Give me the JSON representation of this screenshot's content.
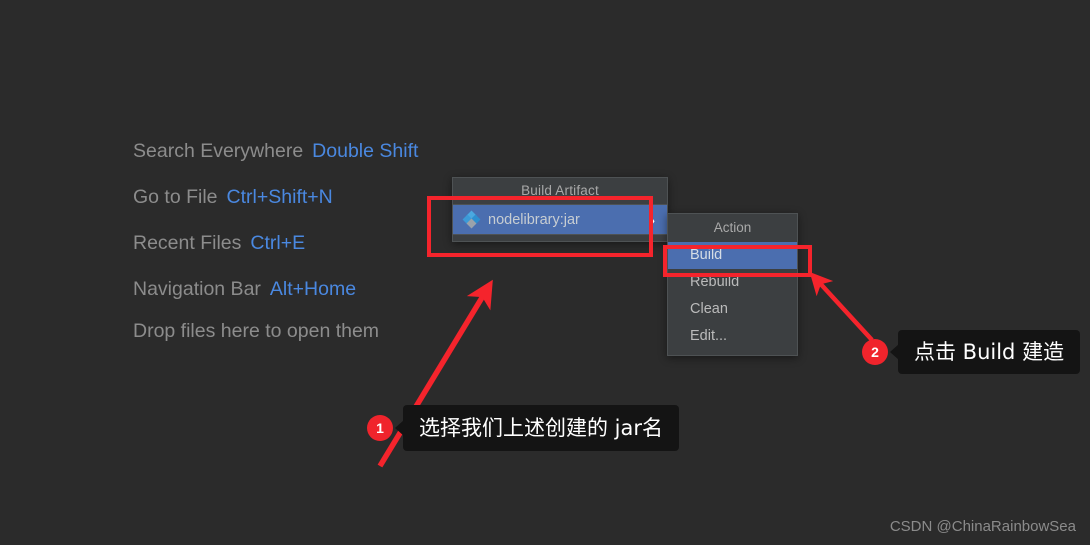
{
  "editor": {
    "hints": [
      {
        "label": "Search Everywhere",
        "shortcut": "Double Shift"
      },
      {
        "label": "Go to File",
        "shortcut": "Ctrl+Shift+N"
      },
      {
        "label": "Recent Files",
        "shortcut": "Ctrl+E"
      },
      {
        "label": "Navigation Bar",
        "shortcut": "Alt+Home"
      }
    ],
    "drop_hint": "Drop files here to open them"
  },
  "build_artifact_popup": {
    "title": "Build Artifact",
    "items": [
      {
        "label": "nodelibrary:jar",
        "icon": "artifact-diamonds-icon",
        "submenu_arrow": "›",
        "selected": true
      }
    ]
  },
  "action_popup": {
    "title": "Action",
    "items": [
      {
        "label": "Build",
        "selected": true
      },
      {
        "label": "Rebuild",
        "selected": false
      },
      {
        "label": "Clean",
        "selected": false
      },
      {
        "label": "Edit...",
        "selected": false
      }
    ]
  },
  "annotations": {
    "highlight_color": "#f5242c",
    "badge_color": "#f0242c",
    "callouts": [
      {
        "number": "1",
        "text": "选择我们上述创建的 jar名"
      },
      {
        "number": "2",
        "text": "点击 Build 建造"
      }
    ]
  },
  "watermark": "CSDN @ChinaRainbowSea",
  "colors": {
    "background": "#2b2b2b",
    "popup_background": "#3c3f41",
    "selection_blue": "#4b6eaf",
    "shortcut_blue": "#4a88e0",
    "hint_gray": "#8c8c8c"
  }
}
